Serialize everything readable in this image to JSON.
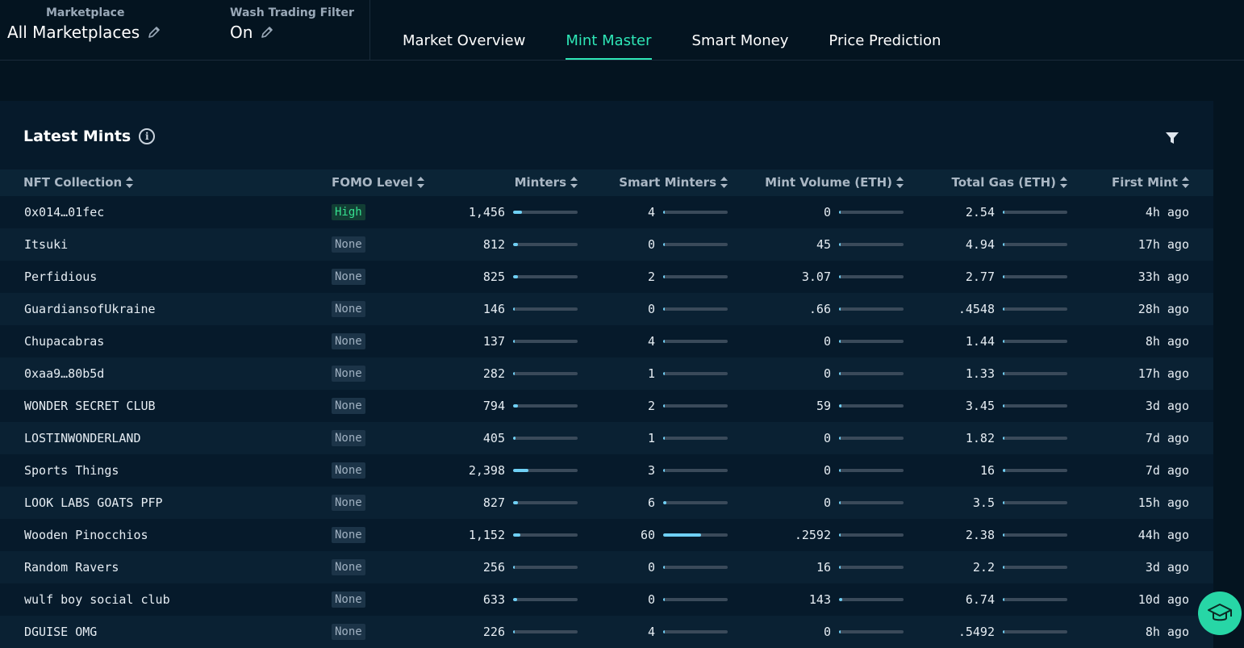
{
  "header": {
    "marketplace_label": "Marketplace",
    "marketplace_value": "All Marketplaces",
    "wash_label": "Wash Trading Filter",
    "wash_value": "On",
    "tabs": [
      "Market Overview",
      "Mint Master",
      "Smart Money",
      "Price Prediction"
    ],
    "active_tab": "Mint Master"
  },
  "card": {
    "title": "Latest Mints"
  },
  "table": {
    "columns": [
      "NFT Collection",
      "FOMO Level",
      "Minters",
      "Smart Minters",
      "Mint Volume (ETH)",
      "Total Gas (ETH)",
      "First Mint"
    ],
    "rows": [
      {
        "name": "0x014…01fec",
        "fomo": "High",
        "minters": "1,456",
        "minters_frac": 0.14,
        "smart": "4",
        "smart_frac": 0.03,
        "volume": "0",
        "volume_frac": 0,
        "gas": "2.54",
        "gas_frac": 0.01,
        "first": "4h ago"
      },
      {
        "name": "Itsuki",
        "fomo": "None",
        "minters": "812",
        "minters_frac": 0.08,
        "smart": "0",
        "smart_frac": 0,
        "volume": "45",
        "volume_frac": 0.03,
        "gas": "4.94",
        "gas_frac": 0.02,
        "first": "17h ago"
      },
      {
        "name": "Perfidious",
        "fomo": "None",
        "minters": "825",
        "minters_frac": 0.08,
        "smart": "2",
        "smart_frac": 0.02,
        "volume": "3.07",
        "volume_frac": 0.005,
        "gas": "2.77",
        "gas_frac": 0.01,
        "first": "33h ago"
      },
      {
        "name": "GuardiansofUkraine",
        "fomo": "None",
        "minters": "146",
        "minters_frac": 0.015,
        "smart": "0",
        "smart_frac": 0,
        "volume": ".66",
        "volume_frac": 0.002,
        "gas": ".4548",
        "gas_frac": 0.002,
        "first": "28h ago"
      },
      {
        "name": "Chupacabras",
        "fomo": "None",
        "minters": "137",
        "minters_frac": 0.015,
        "smart": "4",
        "smart_frac": 0.03,
        "volume": "0",
        "volume_frac": 0,
        "gas": "1.44",
        "gas_frac": 0.005,
        "first": "8h ago"
      },
      {
        "name": "0xaa9…80b5d",
        "fomo": "None",
        "minters": "282",
        "minters_frac": 0.03,
        "smart": "1",
        "smart_frac": 0.01,
        "volume": "0",
        "volume_frac": 0,
        "gas": "1.33",
        "gas_frac": 0.005,
        "first": "17h ago"
      },
      {
        "name": "WONDER SECRET CLUB",
        "fomo": "None",
        "minters": "794",
        "minters_frac": 0.08,
        "smart": "2",
        "smart_frac": 0.02,
        "volume": "59",
        "volume_frac": 0.035,
        "gas": "3.45",
        "gas_frac": 0.015,
        "first": "3d ago"
      },
      {
        "name": "LOSTINWONDERLAND",
        "fomo": "None",
        "minters": "405",
        "minters_frac": 0.04,
        "smart": "1",
        "smart_frac": 0.01,
        "volume": "0",
        "volume_frac": 0,
        "gas": "1.82",
        "gas_frac": 0.007,
        "first": "7d ago"
      },
      {
        "name": "Sports Things",
        "fomo": "None",
        "minters": "2,398",
        "minters_frac": 0.24,
        "smart": "3",
        "smart_frac": 0.025,
        "volume": "0",
        "volume_frac": 0,
        "gas": "16",
        "gas_frac": 0.04,
        "first": "7d ago"
      },
      {
        "name": "LOOK LABS GOATS PFP",
        "fomo": "None",
        "minters": "827",
        "minters_frac": 0.08,
        "smart": "6",
        "smart_frac": 0.05,
        "volume": "0",
        "volume_frac": 0,
        "gas": "3.5",
        "gas_frac": 0.014,
        "first": "15h ago"
      },
      {
        "name": "Wooden Pinocchios",
        "fomo": "None",
        "minters": "1,152",
        "minters_frac": 0.115,
        "smart": "60",
        "smart_frac": 0.59,
        "volume": ".2592",
        "volume_frac": 0.001,
        "gas": "2.38",
        "gas_frac": 0.01,
        "first": "44h ago"
      },
      {
        "name": "Random Ravers",
        "fomo": "None",
        "minters": "256",
        "minters_frac": 0.025,
        "smart": "0",
        "smart_frac": 0,
        "volume": "16",
        "volume_frac": 0.015,
        "gas": "2.2",
        "gas_frac": 0.009,
        "first": "3d ago"
      },
      {
        "name": "wulf boy social club",
        "fomo": "None",
        "minters": "633",
        "minters_frac": 0.065,
        "smart": "0",
        "smart_frac": 0,
        "volume": "143",
        "volume_frac": 0.05,
        "gas": "6.74",
        "gas_frac": 0.025,
        "first": "10d ago"
      },
      {
        "name": "DGUISE OMG",
        "fomo": "None",
        "minters": "226",
        "minters_frac": 0.023,
        "smart": "4",
        "smart_frac": 0.03,
        "volume": "0",
        "volume_frac": 0,
        "gas": ".5492",
        "gas_frac": 0.002,
        "first": "8h ago"
      }
    ]
  },
  "colors": {
    "accent": "#2ee6b6",
    "bar_fill": "#6fd0f5",
    "high_text": "#35e08f",
    "fab": "#27d6a6"
  },
  "icons": [
    "pencil-icon",
    "info-icon",
    "filter-icon",
    "sort-icon",
    "graduation-cap-icon"
  ]
}
